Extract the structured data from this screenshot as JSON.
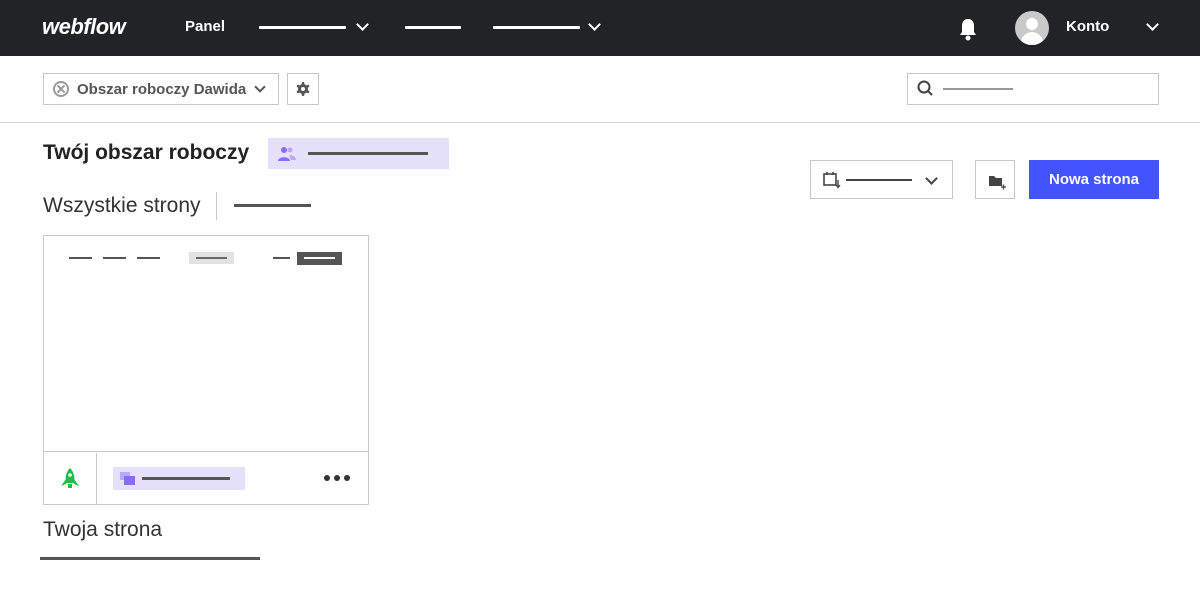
{
  "brand": {
    "logo": "webflow"
  },
  "topnav": {
    "panel_label": "Panel",
    "account_label": "Konto"
  },
  "toolbar": {
    "workspace_label": "Obszar roboczy Dawida"
  },
  "workspace": {
    "title": "Twój obszar roboczy",
    "all_pages_tab": "Wszystkie strony"
  },
  "actions": {
    "new_page_label": "Nowa strona"
  },
  "site_card": {
    "title": "Twoja strona"
  },
  "colors": {
    "topbar": "#222326",
    "accent": "#4353ff",
    "pill": "#e6e1fa",
    "publish": "#1bbd4f"
  }
}
